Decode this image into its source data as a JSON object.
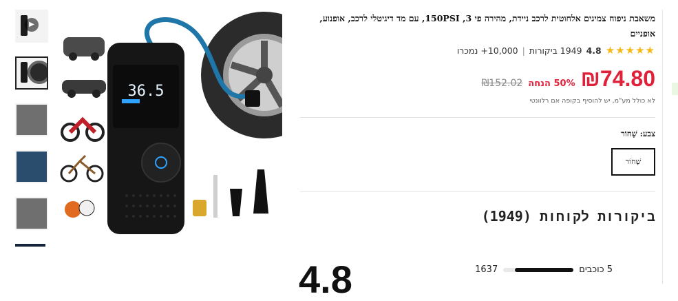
{
  "product": {
    "title": "משאבת ניפוח צמיגים אלחוטית לרכב ניידת, מהירה פי 3, 150PSI, עם מד דיגיטלי לרכב, אופנוע, אופניים",
    "rating": "4.8",
    "stars": "★★★★★",
    "reviews_text": "1949 ביקורות",
    "sold_text": "10,000+ נמכרו",
    "price": "₪74.80",
    "discount": "50% הנחה",
    "old_price": "₪152.02",
    "vat_note": "לא כולל מע\"מ, יש להוסיף בקופה אם רלוונטי",
    "color_label": "צבע: שָׁחוֹר",
    "color_option": "שָׁחוֹר",
    "device_display": "36.5"
  },
  "reviews": {
    "title": "ביקורות לקוחות (1949)",
    "score": "4.8",
    "breakdown": [
      {
        "label": "5 כוכבים",
        "count": "1637",
        "fill": 0.84
      }
    ]
  },
  "colors": {
    "price": "#e0213a",
    "stars": "#f6b712"
  }
}
